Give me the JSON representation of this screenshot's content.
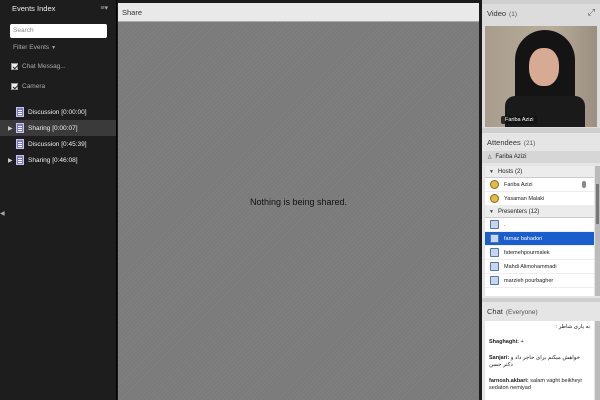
{
  "left": {
    "title": "Events Index",
    "menu_icon": "≡▾",
    "search_placeholder": "Search",
    "filter_label": "Filter Events",
    "checks": [
      {
        "label": "Chat Messag..."
      },
      {
        "label": "Camera"
      }
    ],
    "events": [
      {
        "label": "Discussion [0:00:00]",
        "expandable": false,
        "selected": false
      },
      {
        "label": "Sharing [0:00:07]",
        "expandable": true,
        "selected": true
      },
      {
        "label": "Discussion [0:45:39]",
        "expandable": false,
        "selected": false
      },
      {
        "label": "Sharing [0:46:08]",
        "expandable": true,
        "selected": false
      }
    ]
  },
  "share": {
    "title": "Share",
    "message": "Nothing is being shared."
  },
  "video": {
    "title": "Video",
    "count": "(1)",
    "participant": "Fariba Azizi"
  },
  "attendees": {
    "title": "Attendees",
    "count": "(21)",
    "me": "Fariba Azizi",
    "hosts_label": "Hosts (2)",
    "hosts": [
      "Fariba Azizi",
      "Yasaman Malaki"
    ],
    "presenters_label": "Presenters (12)",
    "presenters": [
      ".",
      "farnaz bahadori",
      "fatemehpourmalek",
      "Mahdi Alimohammadi",
      "marzieh pourbagher"
    ],
    "selected_presenter": "farnaz bahadori"
  },
  "chat": {
    "title": "Chat",
    "scope": "(Everyone)",
    "messages": [
      {
        "sender": "",
        "text": "به یاری شاطر :"
      },
      {
        "sender": "Shaghaghi:",
        "text": "+"
      },
      {
        "sender": "Sanjari:",
        "text": "خواهش میکنم برای حاجر داد و دکتر حسن"
      },
      {
        "sender": "farnosh.akbari:",
        "text": "salam vaght beikheyr sedaton nemiyad"
      }
    ]
  },
  "colors": {
    "selection": "#1a5dcd",
    "share_bg": "#7b7b7b",
    "dark_panel": "#1d1d1d"
  }
}
